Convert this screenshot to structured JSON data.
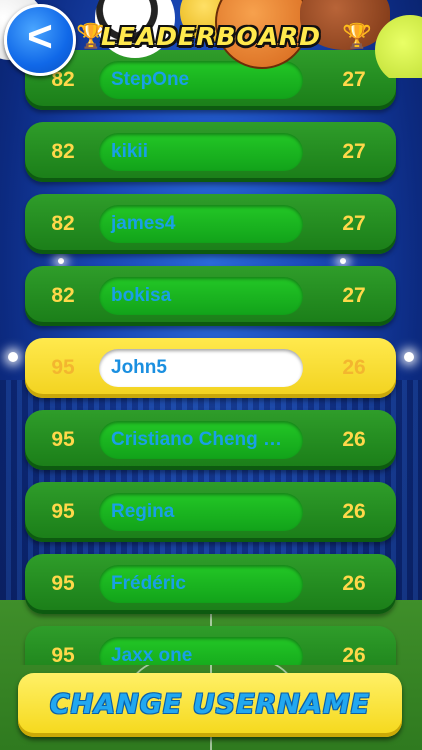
{
  "header": {
    "title": "LEADERBOARD",
    "back_label": "<",
    "trophy_glyph": "🏆"
  },
  "leaderboard": [
    {
      "rank": "82",
      "name": "StepOne",
      "score": "27",
      "current_user": false
    },
    {
      "rank": "82",
      "name": "kikii",
      "score": "27",
      "current_user": false
    },
    {
      "rank": "82",
      "name": "james4",
      "score": "27",
      "current_user": false
    },
    {
      "rank": "82",
      "name": "bokisa",
      "score": "27",
      "current_user": false
    },
    {
      "rank": "95",
      "name": "John5",
      "score": "26",
      "current_user": true
    },
    {
      "rank": "95",
      "name": "Cristiano Cheng Ta...",
      "score": "26",
      "current_user": false
    },
    {
      "rank": "95",
      "name": "Regina",
      "score": "26",
      "current_user": false
    },
    {
      "rank": "95",
      "name": "Frédéric",
      "score": "26",
      "current_user": false
    },
    {
      "rank": "95",
      "name": "Jaxx one",
      "score": "26",
      "current_user": false
    }
  ],
  "footer": {
    "change_username_label": "CHANGE USERNAME"
  },
  "colors": {
    "row_green": "#1a7d18",
    "highlight_yellow": "#ffe94d",
    "name_text_blue": "#19a0e6",
    "score_text_gold": "#ffd84a"
  },
  "icons": {
    "back": "chevron-left-icon",
    "trophy": "trophy-icon"
  }
}
